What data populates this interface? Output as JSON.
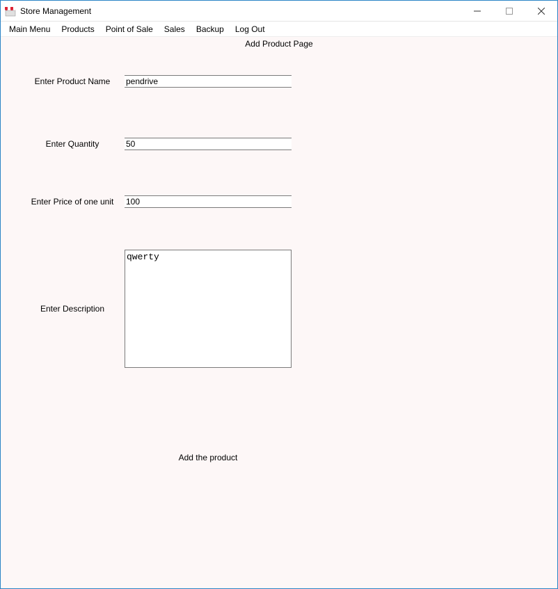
{
  "window": {
    "title": "Store Management",
    "icon": "store-awning-icon"
  },
  "menubar": {
    "items": [
      "Main Menu",
      "Products",
      "Point of Sale",
      "Sales",
      "Backup",
      "Log Out"
    ]
  },
  "page": {
    "title": "Add Product Page"
  },
  "form": {
    "name_label": "Enter Product Name",
    "name_value": "pendrive",
    "quantity_label": "Enter Quantity",
    "quantity_value": "50",
    "price_label": "Enter Price of one unit",
    "price_value": "100",
    "description_label": "Enter Description",
    "description_value": "qwerty",
    "submit_label": "Add the product"
  }
}
